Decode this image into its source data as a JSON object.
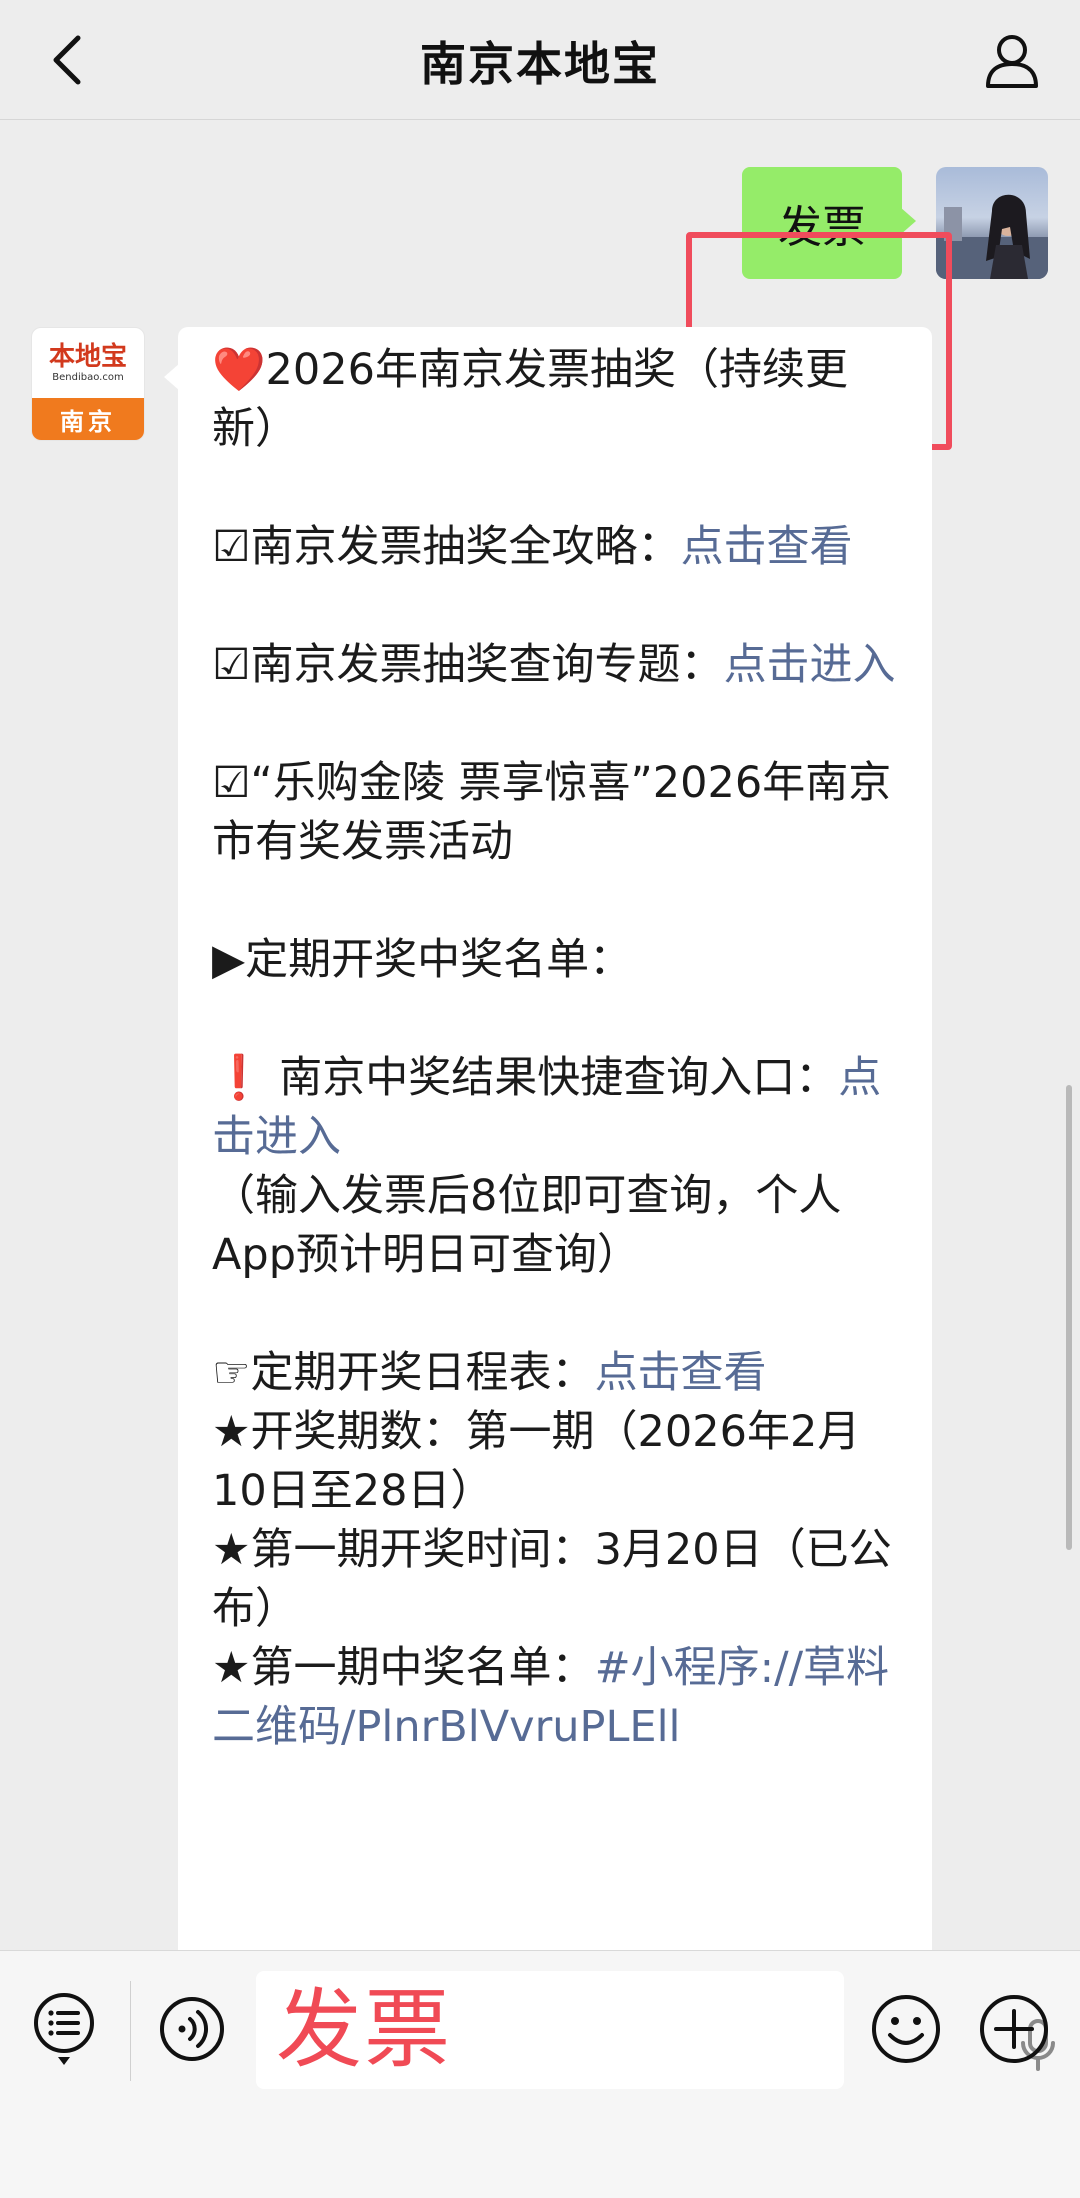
{
  "header": {
    "title": "南京本地宝",
    "back_icon": "chevron-left-icon",
    "profile_icon": "person-icon"
  },
  "chat": {
    "sent_message": "发票",
    "bot_avatar": {
      "brand": "本地宝",
      "site": "Bendibao.com",
      "city": "南京"
    },
    "reply": {
      "title_emoji": "❤️",
      "title": "2026年南京发票抽奖（持续更新）",
      "item1_prefix": "☑南京发票抽奖全攻略：",
      "item1_link": "点击查看",
      "item2_prefix": "☑南京发票抽奖查询专题：",
      "item2_link": "点击进入",
      "item3": "☑“乐购金陵 票享惊喜”2026年南京市有奖发票活动",
      "section": "▶定期开奖中奖名单：",
      "quick_prefix_emoji": "❗",
      "quick_text": "南京中奖结果快捷查询入口：",
      "quick_link": "点击进入",
      "quick_note": "（输入发票后8位即可查询，个人App预计明日可查询）",
      "schedule_prefix": "☞定期开奖日程表：",
      "schedule_link": "点击查看",
      "line_period": "★开奖期数：第一期（2026年2月10日至28日）",
      "line_time": "★第一期开奖时间：3月20日（已公布）",
      "line_winners_prefix": "★第一期中奖名单：",
      "line_winners_link": "#小程序://草料二维码/PlnrBlVvruPLEll"
    }
  },
  "inputbar": {
    "input_text": "发票",
    "icons": [
      "list-icon",
      "voice-icon",
      "mic-icon",
      "emoji-icon",
      "plus-icon"
    ]
  },
  "colors": {
    "sent_bubble": "#95ec69",
    "link": "#576b95",
    "highlight": "#f04c5c",
    "input_text": "#f04a55"
  }
}
